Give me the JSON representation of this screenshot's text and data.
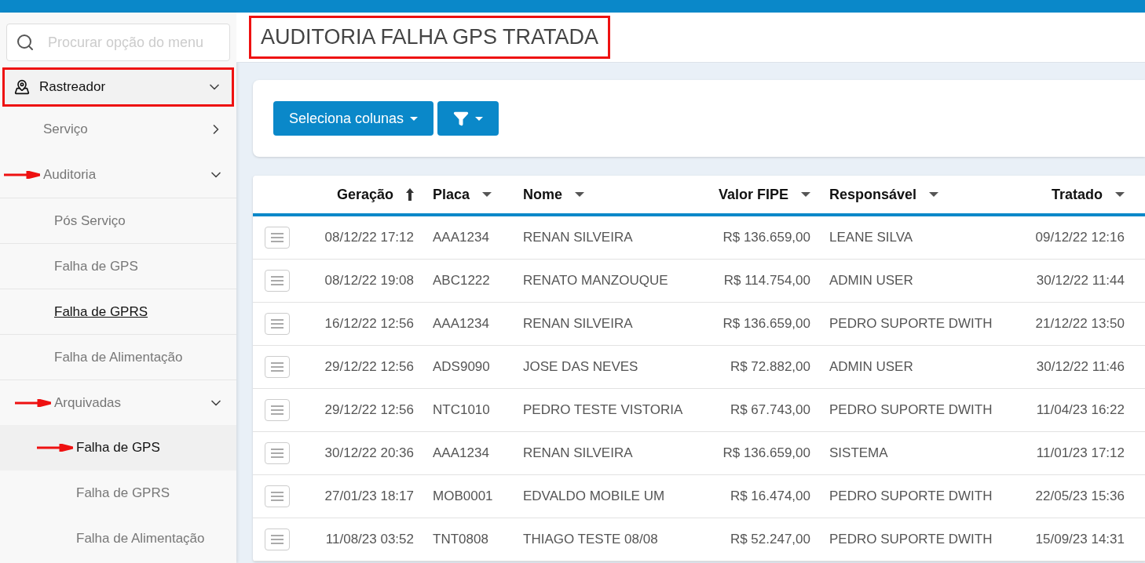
{
  "sidebar": {
    "search": {
      "placeholder": "Procurar opção do menu"
    },
    "items": [
      {
        "label": "Rastreador",
        "expanded": true,
        "highlighted": true,
        "children": [
          {
            "label": "Serviço",
            "expanded": false,
            "pointed": false
          },
          {
            "label": "Auditoria",
            "expanded": true,
            "pointed": true,
            "children": [
              {
                "label": "Pós Serviço",
                "hovered": false,
                "pointed": false
              },
              {
                "label": "Falha de GPS",
                "hovered": false,
                "pointed": false
              },
              {
                "label": "Falha de GPRS",
                "hovered": true,
                "pointed": false
              },
              {
                "label": "Falha de Alimentação",
                "hovered": false,
                "pointed": false
              },
              {
                "label": "Arquivadas",
                "expanded": true,
                "pointed": true,
                "children": [
                  {
                    "label": "Falha de GPS",
                    "selected": true,
                    "pointed": true
                  },
                  {
                    "label": "Falha de GPRS",
                    "selected": false,
                    "pointed": false
                  },
                  {
                    "label": "Falha de Alimentação",
                    "selected": false,
                    "pointed": false
                  }
                ]
              }
            ]
          }
        ]
      }
    ]
  },
  "page": {
    "title": "AUDITORIA FALHA GPS TRATADA",
    "highlighted": true
  },
  "toolbar": {
    "columns_button": "Seleciona colunas"
  },
  "table": {
    "columns": [
      {
        "label": "Geração",
        "sorted": true
      },
      {
        "label": "Placa",
        "sorted": false
      },
      {
        "label": "Nome",
        "sorted": false
      },
      {
        "label": "Valor FIPE",
        "sorted": false
      },
      {
        "label": "Responsável",
        "sorted": false
      },
      {
        "label": "Tratado",
        "sorted": false
      }
    ],
    "rows": [
      [
        "08/12/22 17:12",
        "AAA1234",
        "RENAN SILVEIRA",
        "R$ 136.659,00",
        "LEANE SILVA",
        "09/12/22 12:16"
      ],
      [
        "08/12/22 19:08",
        "ABC1222",
        "RENATO MANZOUQUE",
        "R$ 114.754,00",
        "ADMIN USER",
        "30/12/22 11:44"
      ],
      [
        "16/12/22 12:56",
        "AAA1234",
        "RENAN SILVEIRA",
        "R$ 136.659,00",
        "PEDRO SUPORTE DWITH",
        "21/12/22 13:50"
      ],
      [
        "29/12/22 12:56",
        "ADS9090",
        "JOSE DAS NEVES",
        "R$ 72.882,00",
        "ADMIN USER",
        "30/12/22 11:46"
      ],
      [
        "29/12/22 12:56",
        "NTC1010",
        "PEDRO TESTE VISTORIA",
        "R$ 67.743,00",
        "PEDRO SUPORTE DWITH",
        "11/04/23 16:22"
      ],
      [
        "30/12/22 20:36",
        "AAA1234",
        "RENAN SILVEIRA",
        "R$ 136.659,00",
        "SISTEMA",
        "11/01/23 17:12"
      ],
      [
        "27/01/23 18:17",
        "MOB0001",
        "EDVALDO MOBILE UM",
        "R$ 16.474,00",
        "PEDRO SUPORTE DWITH",
        "22/05/23 15:36"
      ],
      [
        "11/08/23 03:52",
        "TNT0808",
        "THIAGO TESTE 08/08",
        "R$ 52.247,00",
        "PEDRO SUPORTE DWITH",
        "15/09/23 14:31"
      ]
    ]
  }
}
